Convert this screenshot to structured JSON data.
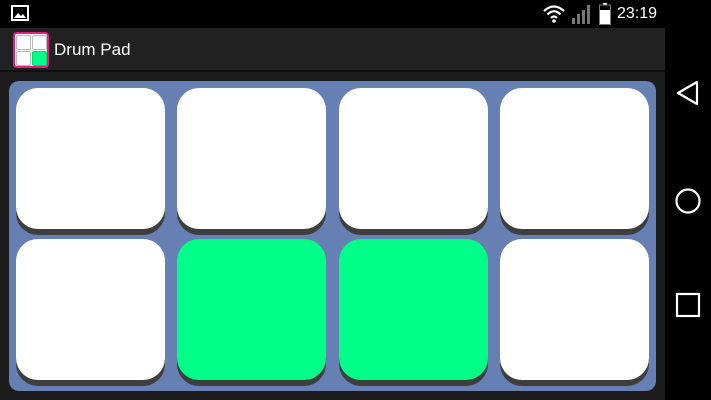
{
  "status_bar": {
    "time": "23:19",
    "icons": [
      "gallery-icon",
      "wifi-icon",
      "signal-icon",
      "battery-icon"
    ]
  },
  "app": {
    "title": "Drum Pad",
    "icon": "drum-pad-app-icon"
  },
  "pads": [
    {
      "row": 1,
      "col": 1,
      "active": false
    },
    {
      "row": 1,
      "col": 2,
      "active": false
    },
    {
      "row": 1,
      "col": 3,
      "active": false
    },
    {
      "row": 1,
      "col": 4,
      "active": false
    },
    {
      "row": 2,
      "col": 1,
      "active": false
    },
    {
      "row": 2,
      "col": 2,
      "active": true
    },
    {
      "row": 2,
      "col": 3,
      "active": true
    },
    {
      "row": 2,
      "col": 4,
      "active": false
    }
  ],
  "colors": {
    "pad_idle": "#ffffff",
    "pad_active": "#00ff88",
    "pad_frame": "#6680b4",
    "action_bar": "#212121",
    "app_icon_border": "#e2207f"
  },
  "nav_bar": {
    "buttons": [
      "back-icon",
      "home-icon",
      "recents-icon"
    ]
  }
}
